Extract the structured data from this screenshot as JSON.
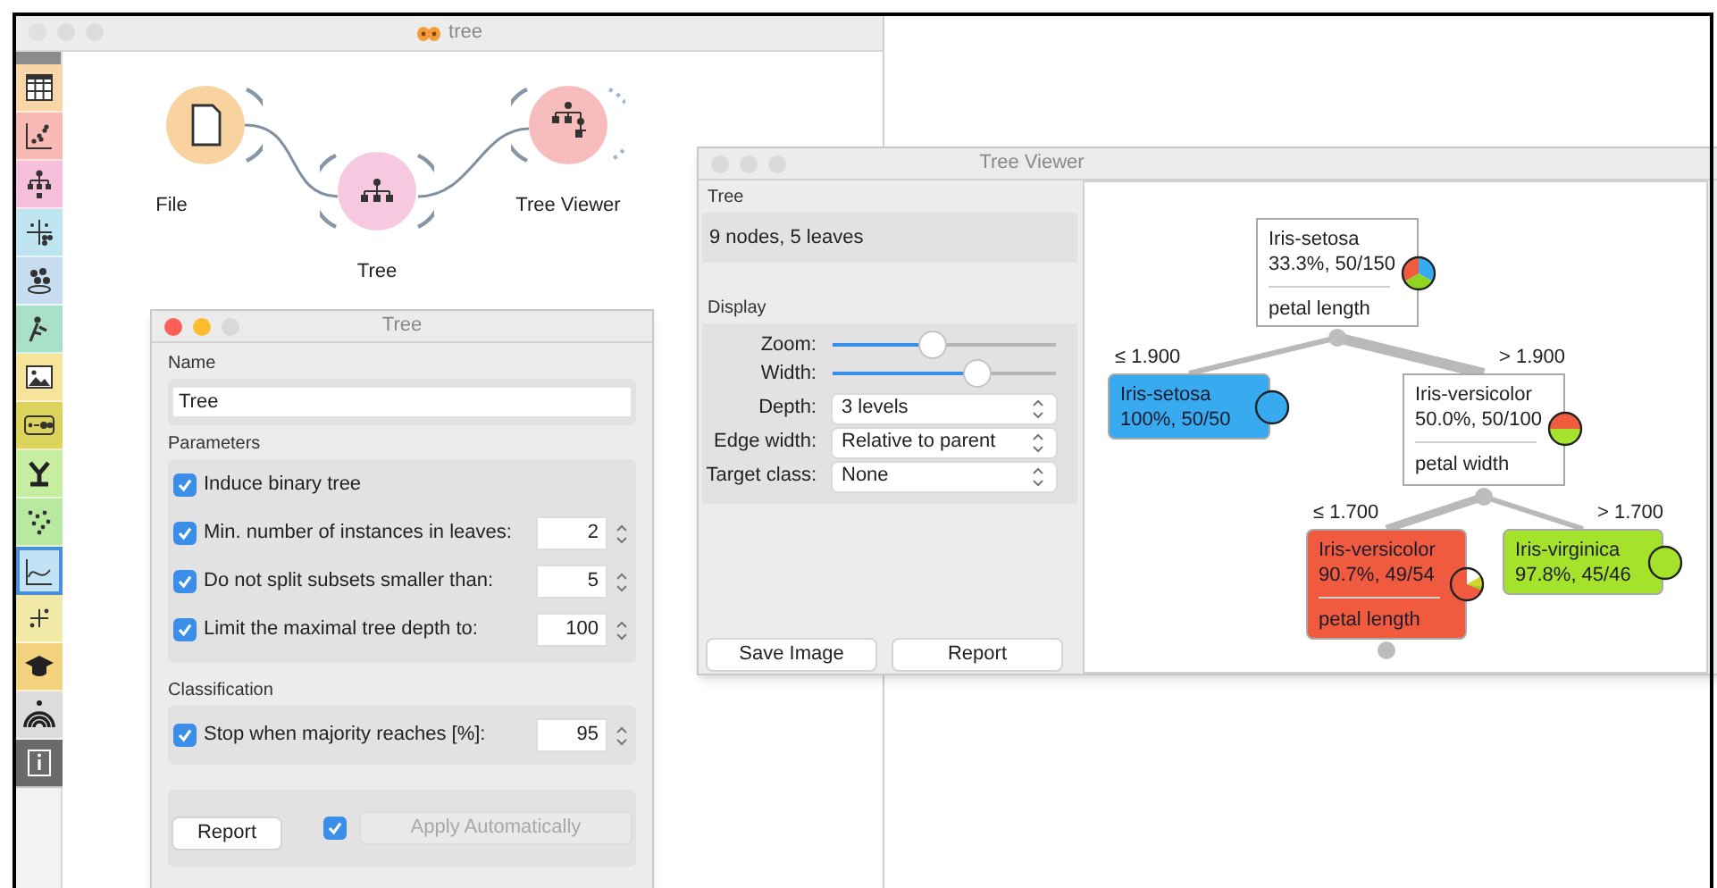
{
  "window": {
    "title": "tree"
  },
  "toolbox": [
    {
      "color": "#f8d6a8",
      "selected": false
    },
    {
      "color": "#f7bab5",
      "selected": false
    },
    {
      "color": "#f6c0dd",
      "selected": false
    },
    {
      "color": "#bfe6f0",
      "selected": false
    },
    {
      "color": "#c8dcf0",
      "selected": false
    },
    {
      "color": "#a8e0c8",
      "selected": false
    },
    {
      "color": "#f5e49a",
      "selected": false
    },
    {
      "color": "#dcd35c",
      "selected": false
    },
    {
      "color": "#c7eea0",
      "selected": false
    },
    {
      "color": "#b9e8a0",
      "selected": false
    },
    {
      "color": "#c2e3f5",
      "selected": true
    },
    {
      "color": "#f1eaa6",
      "selected": false
    },
    {
      "color": "#f4d37e",
      "selected": false
    },
    {
      "color": "#dcdcdc",
      "selected": false
    },
    {
      "color": "#6a6a6a",
      "selected": false
    }
  ],
  "workflow": [
    {
      "label": "File",
      "kind": "file",
      "color": "#f8d3a0"
    },
    {
      "label": "Tree",
      "kind": "tree",
      "color": "#f6c9e0"
    },
    {
      "label": "Tree Viewer",
      "kind": "viewer",
      "color": "#f7bcbc"
    }
  ],
  "tree_widget": {
    "title": "Tree",
    "name": {
      "label": "Name",
      "value": "Tree"
    },
    "parameters": {
      "label": "Parameters",
      "options": [
        {
          "label": "Induce binary tree",
          "checked": true
        },
        {
          "label": "Min. number of instances in leaves:",
          "checked": true,
          "value": "2"
        },
        {
          "label": "Do not split subsets smaller than:",
          "checked": true,
          "value": "5"
        },
        {
          "label": "Limit the maximal tree depth to:",
          "checked": true,
          "value": "100"
        }
      ]
    },
    "classification": {
      "label": "Classification",
      "options": [
        {
          "label": "Stop when majority reaches [%]:",
          "checked": true,
          "value": "95"
        }
      ]
    },
    "report_button": "Report",
    "auto_apply": {
      "checked": true,
      "label": "Apply Automatically",
      "disabled": true
    }
  },
  "tree_viewer": {
    "title": "Tree Viewer",
    "info": {
      "label": "Tree",
      "text": "9 nodes, 5 leaves"
    },
    "display": {
      "label": "Display",
      "sliders": [
        {
          "label": "Zoom:",
          "level": 0.45
        },
        {
          "label": "Width:",
          "level": 0.65
        }
      ],
      "combos": [
        {
          "label": "Depth:",
          "value": "3 levels"
        },
        {
          "label": "Edge width:",
          "value": "Relative to parent"
        },
        {
          "label": "Target class:",
          "value": "None"
        }
      ]
    },
    "buttons": [
      "Save Image",
      "Report"
    ],
    "tree": {
      "class": "Iris-setosa",
      "stats": "33.3%, 50/150",
      "split": "petal length",
      "children": [
        {
          "condition": "≤ 1.900",
          "class": "Iris-setosa",
          "stats": "100%, 50/50",
          "color": "#38aaef"
        },
        {
          "condition": "> 1.900",
          "class": "Iris-versicolor",
          "stats": "50.0%, 50/100",
          "split": "petal width",
          "children": [
            {
              "condition": "≤ 1.700",
              "class": "Iris-versicolor",
              "stats": "90.7%, 49/54",
              "split": "petal length",
              "color": "#f05b3f"
            },
            {
              "condition": "> 1.700",
              "class": "Iris-virginica",
              "stats": "97.8%, 45/46",
              "color": "#a5e22c"
            }
          ]
        }
      ]
    }
  }
}
